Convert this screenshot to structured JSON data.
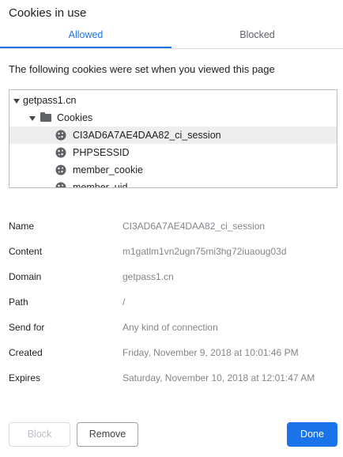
{
  "dialog": {
    "title": "Cookies in use",
    "tabs": [
      {
        "label": "Allowed",
        "active": true
      },
      {
        "label": "Blocked",
        "active": false
      }
    ],
    "description": "The following cookies were set when you viewed this page"
  },
  "tree": {
    "domain": "getpass1.cn",
    "folder": "Cookies",
    "cookies": [
      {
        "name": "CI3AD6A7AE4DAA82_ci_session",
        "selected": true
      },
      {
        "name": "PHPSESSID",
        "selected": false
      },
      {
        "name": "member_cookie",
        "selected": false
      },
      {
        "name": "member_uid",
        "selected": false
      }
    ]
  },
  "details": [
    {
      "label": "Name",
      "value": "CI3AD6A7AE4DAA82_ci_session"
    },
    {
      "label": "Content",
      "value": "m1gatlm1vn2ugn75mi3hg72iuaoug03d"
    },
    {
      "label": "Domain",
      "value": "getpass1.cn"
    },
    {
      "label": "Path",
      "value": "/"
    },
    {
      "label": "Send for",
      "value": "Any kind of connection"
    },
    {
      "label": "Created",
      "value": "Friday, November 9, 2018 at 10:01:46 PM"
    },
    {
      "label": "Expires",
      "value": "Saturday, November 10, 2018 at 12:01:47 AM"
    }
  ],
  "buttons": {
    "block": "Block",
    "remove": "Remove",
    "done": "Done"
  },
  "colors": {
    "accent": "#1a73e8",
    "selected_row": "#eeeeee",
    "value_text": "#80868b"
  }
}
